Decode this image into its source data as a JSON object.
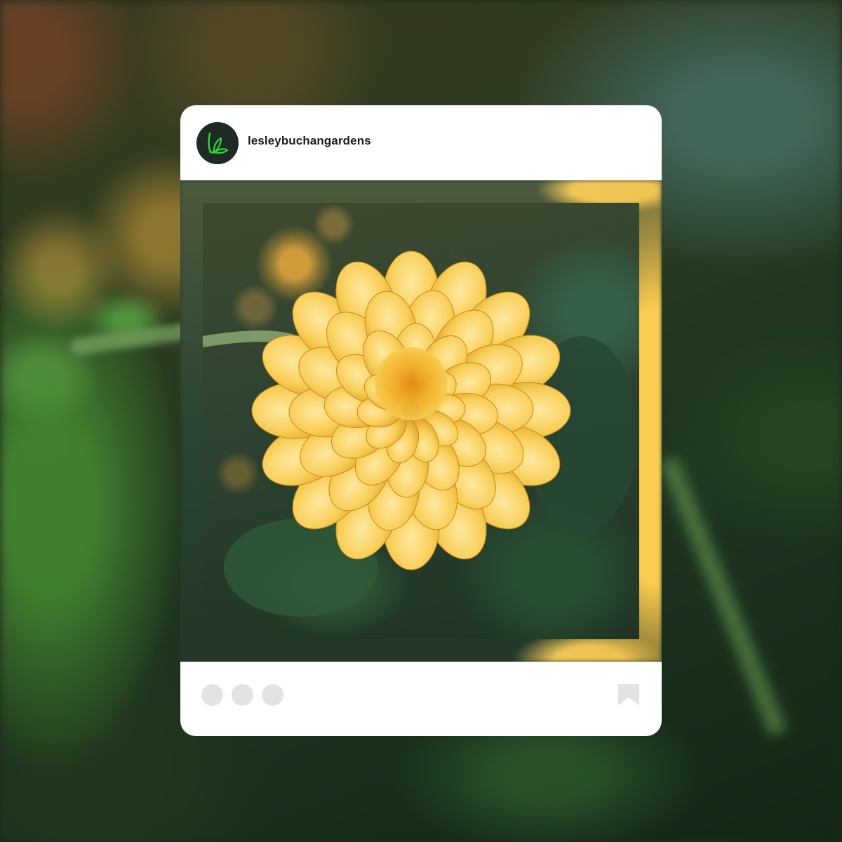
{
  "post": {
    "username": "lesleybuchangardens",
    "avatar": {
      "icon": "lb-leaf-logo-icon",
      "background_color": "#1f2a24",
      "accent_color": "#2bd93a"
    },
    "photo": {
      "subject": "yellow-dahlia-photo"
    },
    "footer": {
      "action_dots": [
        "action-dot-1",
        "action-dot-2",
        "action-dot-3"
      ],
      "bookmark_icon": "bookmark-icon",
      "placeholder_color": "#e3e3e3"
    }
  }
}
